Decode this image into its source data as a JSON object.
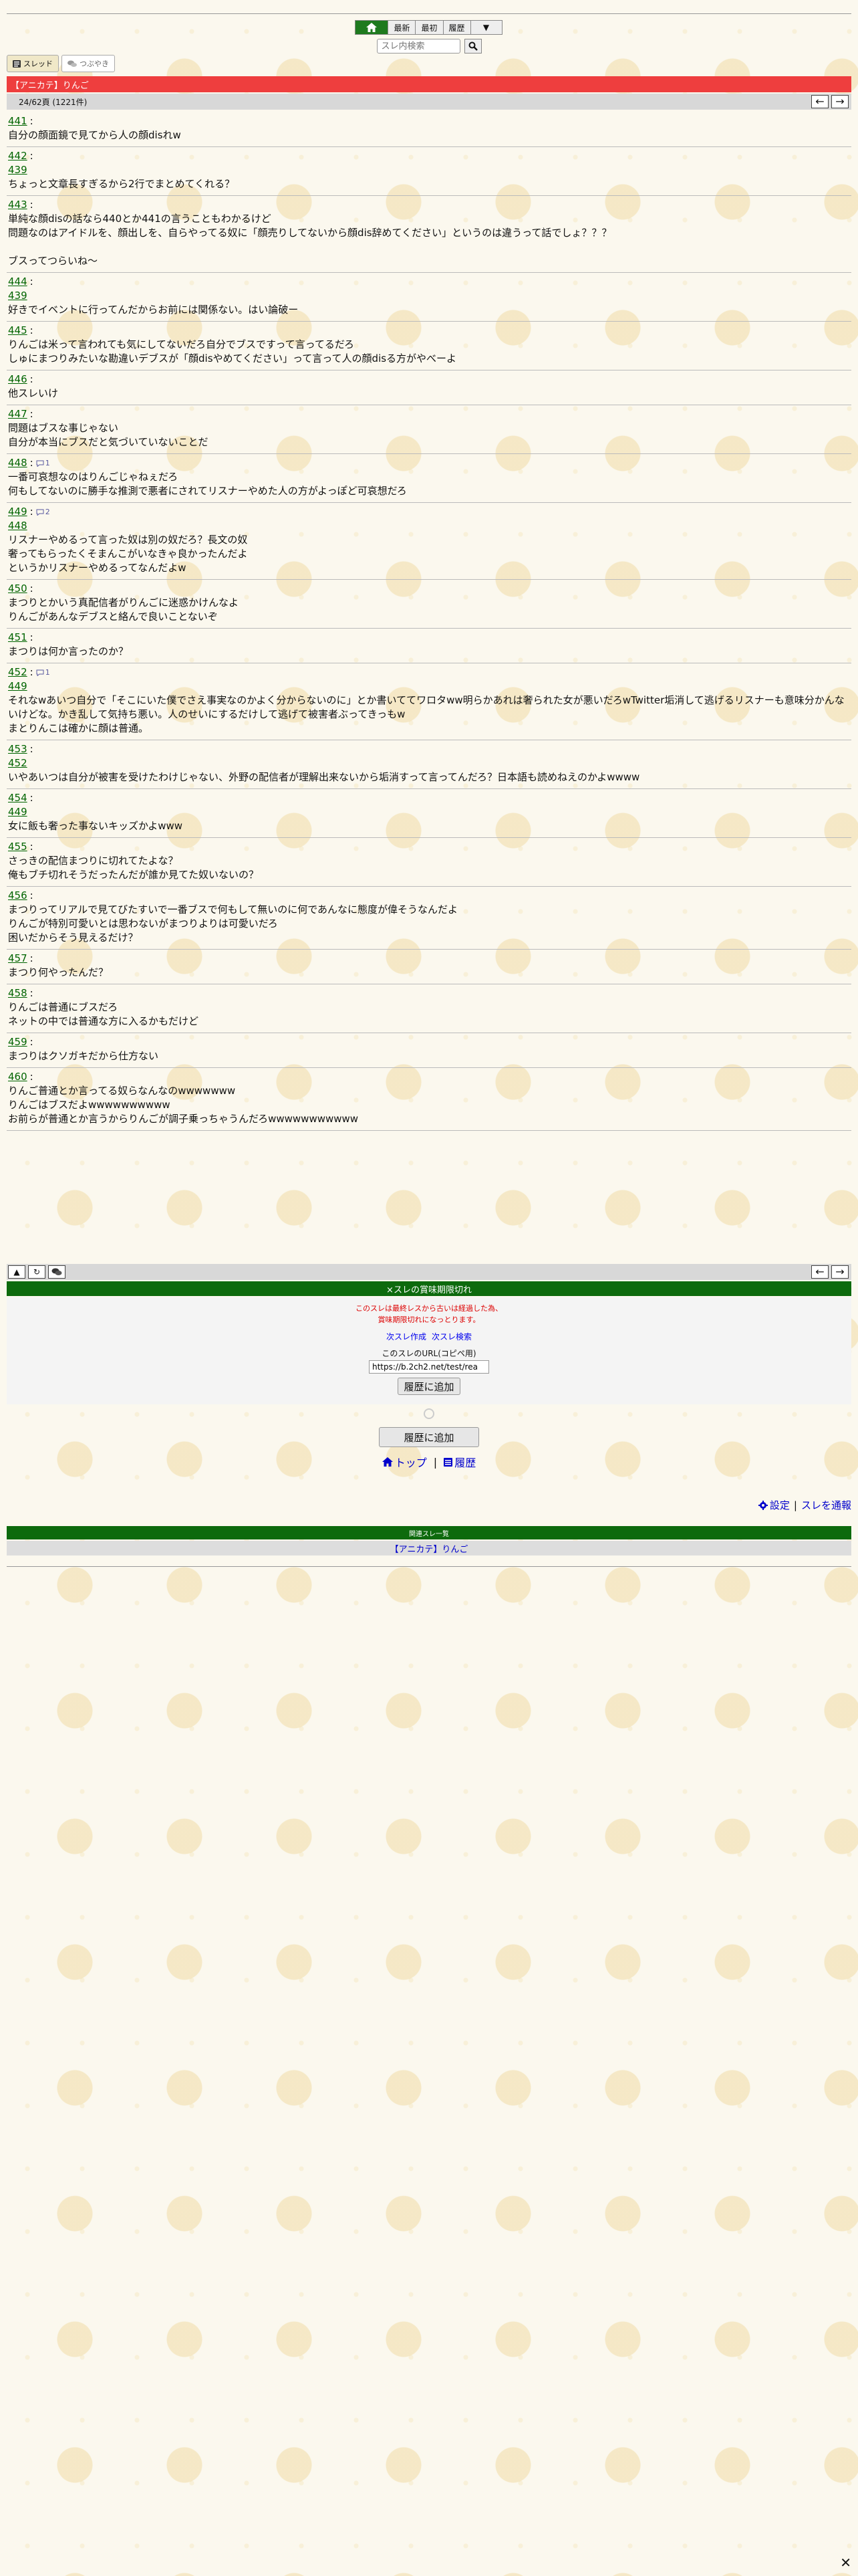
{
  "nav": {
    "buttons": [
      "最新",
      "最初",
      "履歴",
      "▼"
    ]
  },
  "search": {
    "placeholder": "スレ内検索"
  },
  "modes": {
    "thread": "スレッド",
    "tsubuyaki": "つぶやき"
  },
  "thread_title": "【アニカテ】りんご",
  "page_info": "24/62頁 (1221件)",
  "posts": [
    {
      "num": "441",
      "lines": [
        "自分の顔面鏡で見てから人の顔disれw"
      ]
    },
    {
      "num": "442",
      "anchor": "439",
      "lines": [
        "ちょっと文章長すぎるから2行でまとめてくれる？"
      ]
    },
    {
      "num": "443",
      "lines": [
        "単純な顔disの話なら440とか441の言うこともわかるけど",
        "問題なのはアイドルを、顔出しを、自らやってる奴に「顔売りしてないから顔dis辞めてください」というのは違うって話でしょ？？？",
        "",
        "ブスってつらいね〜"
      ]
    },
    {
      "num": "444",
      "anchor": "439",
      "lines": [
        "好きでイベントに行ってんだからお前には関係ない。はい論破ー"
      ]
    },
    {
      "num": "445",
      "lines": [
        "りんごは米って言われても気にしてないだろ自分でブスですって言ってるだろ",
        "しゅにまつりみたいな勘違いデブスが「顔disやめてください」って言って人の顔disる方がやべーよ"
      ]
    },
    {
      "num": "446",
      "lines": [
        "他スレいけ"
      ]
    },
    {
      "num": "447",
      "lines": [
        "問題はブスな事じゃない",
        "自分が本当にブスだと気づいていないことだ"
      ]
    },
    {
      "num": "448",
      "replies": "1",
      "lines": [
        "一番可哀想なのはりんごじゃねぇだろ",
        "何もしてないのに勝手な推測で悪者にされてリスナーやめた人の方がよっぽど可哀想だろ"
      ]
    },
    {
      "num": "449",
      "replies": "2",
      "anchor": "448",
      "lines": [
        "リスナーやめるって言った奴は別の奴だろ？長文の奴",
        "奢ってもらったくそまんこがいなきゃ良かったんだよ",
        "というかリスナーやめるってなんだよw"
      ]
    },
    {
      "num": "450",
      "lines": [
        "まつりとかいう真配信者がりんごに迷惑かけんなよ",
        "りんごがあんなデブスと絡んで良いことないぞ"
      ]
    },
    {
      "num": "451",
      "lines": [
        "まつりは何か言ったのか？"
      ]
    },
    {
      "num": "452",
      "replies": "1",
      "anchor": "449",
      "lines": [
        "それなwあいつ自分で「そこにいた僕でさえ事実なのかよく分からないのに」とか書いててワロタww明らかあれは奢られた女が悪いだろwTwitter垢消して逃げるリスナーも意味分かんないけどな。かき乱して気持ち悪い。人のせいにするだけして逃げて被害者ぶってきっもw",
        "まとりんこは確かに顔は普通。"
      ]
    },
    {
      "num": "453",
      "anchor": "452",
      "lines": [
        "いやあいつは自分が被害を受けたわけじゃない、外野の配信者が理解出来ないから垢消すって言ってんだろ？日本語も読めねえのかよwwww"
      ]
    },
    {
      "num": "454",
      "anchor": "449",
      "lines": [
        "女に飯も奢った事ないキッズかよwww"
      ]
    },
    {
      "num": "455",
      "lines": [
        "さっきの配信まつりに切れてたよな？",
        "俺もブチ切れそうだったんだが誰か見てた奴いないの？"
      ]
    },
    {
      "num": "456",
      "lines": [
        "まつりってリアルで見てびたすいで一番ブスで何もして無いのに何であんなに態度が偉そうなんだよ",
        "りんごが特別可愛いとは思わないがまつりよりは可愛いだろ",
        "困いだからそう見えるだけ？"
      ]
    },
    {
      "num": "457",
      "lines": [
        "まつり何やったんだ？"
      ]
    },
    {
      "num": "458",
      "lines": [
        "りんごは普通にブスだろ",
        "ネットの中では普通な方に入るかもだけど"
      ]
    },
    {
      "num": "459",
      "lines": [
        "まつりはクソガキだから仕方ない"
      ]
    },
    {
      "num": "460",
      "lines": [
        "りんご普通とか言ってる奴らなんなのwwwwwww",
        "りんごはブスだよwwwwwwwwww",
        "お前らが普通とか言うからりんごが調子乗っちゃうんだろwwwwwwwwwww"
      ]
    }
  ],
  "closed": {
    "header": "×スレの賞味期限切れ",
    "msg1": "このスレは最終レスから古いは経過した為、",
    "msg2": "賞味期限切れになっとります。",
    "link_make": "次スレ作成",
    "link_search": "次スレ検索",
    "url_caption": "このスレのURL(コピペ用)",
    "url_value": "https://b.2ch2.net/test/rea",
    "add_history": "履歴に追加"
  },
  "add_history_2": "履歴に追加",
  "footer": {
    "top": "トップ",
    "history": "履歴",
    "sep": "|"
  },
  "settings": {
    "settings": "設定",
    "sep": "|",
    "report": "スレを通報"
  },
  "related": {
    "header": "関連スレ一覧",
    "item": "【アニカテ】りんご"
  },
  "colors": {
    "red_bar": "#ee3e3e",
    "dark_green": "#0d6a0d",
    "link_green": "#006400"
  }
}
